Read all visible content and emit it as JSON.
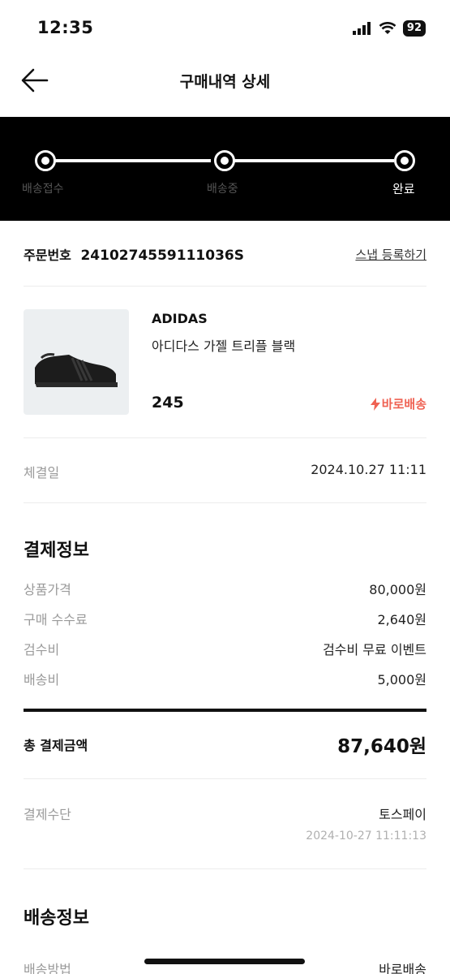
{
  "status": {
    "time": "12:35",
    "battery": "92"
  },
  "header": {
    "title": "구매내역 상세"
  },
  "progress": {
    "steps": [
      {
        "label": "배송접수"
      },
      {
        "label": "배송중"
      },
      {
        "label": "완료"
      }
    ]
  },
  "order": {
    "label": "주문번호",
    "number": "2410274559111036S",
    "snap_link": "스냅 등록하기"
  },
  "product": {
    "brand": "ADIDAS",
    "name": "아디다스 가젤 트리플 블랙",
    "size": "245",
    "delivery_badge": "바로배송"
  },
  "contract": {
    "label": "체결일",
    "value": "2024.10.27 11:11"
  },
  "payment": {
    "title": "결제정보",
    "items": [
      {
        "label": "상품가격",
        "value": "80,000원"
      },
      {
        "label": "구매 수수료",
        "value": "2,640원"
      },
      {
        "label": "검수비",
        "value": "검수비 무료 이벤트"
      },
      {
        "label": "배송비",
        "value": "5,000원"
      }
    ],
    "total_label": "총 결제금액",
    "total_value": "87,640원",
    "method_label": "결제수단",
    "method_value": "토스페이",
    "method_time": "2024-10-27 11:11:13"
  },
  "shipping": {
    "title": "배송정보",
    "method_label": "배송방법",
    "method_value": "바로배송"
  },
  "colors": {
    "accent": "#ef6253",
    "black": "#000000"
  }
}
